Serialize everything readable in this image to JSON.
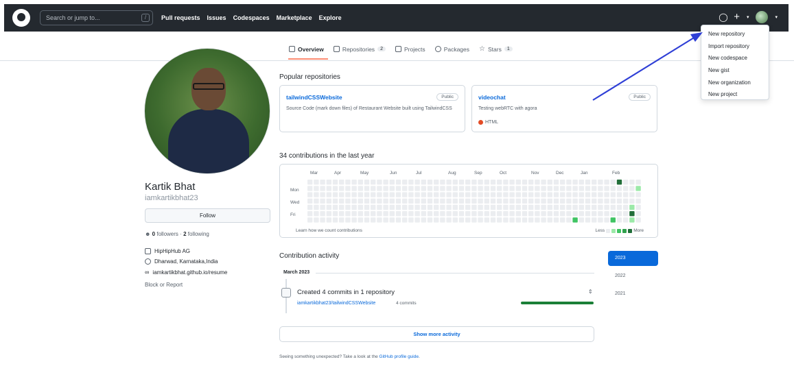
{
  "header": {
    "search_placeholder": "Search or jump to...",
    "search_shortcut": "/",
    "nav": [
      "Pull requests",
      "Issues",
      "Codespaces",
      "Marketplace",
      "Explore"
    ],
    "bell_icon": "bell-icon",
    "plus_icon": "plus-icon"
  },
  "dropdown": {
    "items": [
      "New repository",
      "Import repository",
      "New codespace",
      "New gist",
      "New organization",
      "New project"
    ]
  },
  "tabs": [
    {
      "label": "Overview",
      "count": ""
    },
    {
      "label": "Repositories",
      "count": "2"
    },
    {
      "label": "Projects",
      "count": ""
    },
    {
      "label": "Packages",
      "count": ""
    },
    {
      "label": "Stars",
      "count": "1"
    }
  ],
  "profile": {
    "name": "Kartik Bhat",
    "username": "iamkartikbhat23",
    "follow_label": "Follow",
    "followers": "0",
    "followers_label": "followers",
    "following": "2",
    "following_label": "following",
    "company": "HipHipHub AG",
    "location": "Dharwad, Karnataka,India",
    "website": "iamkartikbhat.github.io/resume",
    "block_report": "Block or Report"
  },
  "popular": {
    "title": "Popular repositories",
    "repos": [
      {
        "name": "tailwindCSSWebsite",
        "badge": "Public",
        "desc": "Source Code (mark down files) of Restaurant Website built using TailwindCSS",
        "lang": ""
      },
      {
        "name": "videochat",
        "badge": "Public",
        "desc": "Testing webRTC with agora",
        "lang": "HTML"
      }
    ]
  },
  "contributions": {
    "title": "34 contributions in the last year",
    "months": [
      "Mar",
      "Apr",
      "May",
      "Jun",
      "Jul",
      "Aug",
      "Sep",
      "Oct",
      "Nov",
      "Dec",
      "Jan",
      "Feb"
    ],
    "days": [
      "Mon",
      "Wed",
      "Fri"
    ],
    "learn": "Learn how we count contributions",
    "less": "Less",
    "more": "More",
    "colors": [
      "#ebedf0",
      "#9be9a8",
      "#40c463",
      "#30a14e",
      "#216e39"
    ]
  },
  "activity": {
    "title": "Contribution activity",
    "years": [
      "2023",
      "2022",
      "2021"
    ],
    "month": "March 2023",
    "commit_title": "Created 4 commits in 1 repository",
    "commit_repo": "iamkartikbhat23/tailwindCSSWebsite",
    "commit_count": "4 commits",
    "show_more": "Show more activity",
    "footer_prefix": "Seeing something unexpected? Take a look at the",
    "footer_link": "GitHub profile guide",
    "footer_suffix": "."
  }
}
